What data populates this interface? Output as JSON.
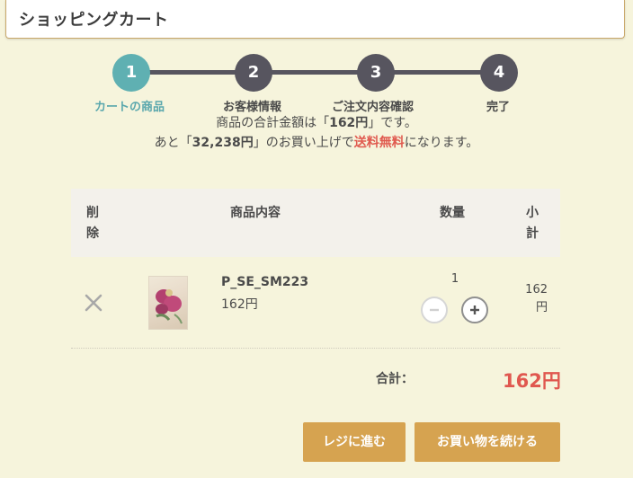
{
  "header": {
    "title": "ショッピングカート"
  },
  "steps": [
    {
      "number": "1",
      "label": "カートの商品",
      "active": true
    },
    {
      "number": "2",
      "label": "お客様情報"
    },
    {
      "number": "3",
      "label": "ご注文内容確認"
    },
    {
      "number": "4",
      "label": "完了"
    }
  ],
  "summary": {
    "line1_prefix": "商品の合計金額は「",
    "line1_amount": "162円",
    "line1_suffix": "」です。",
    "line2_prefix": "あと「",
    "line2_amount": "32,238円",
    "line2_mid": "」のお買い上げで",
    "line2_free": "送料無料",
    "line2_suffix": "になります。"
  },
  "table": {
    "headers": {
      "delete": "削\n除",
      "item": "商品内容",
      "qty": "数量",
      "subtotal": "小\n計"
    },
    "rows": [
      {
        "name": "P_SE_SM223",
        "price": "162円",
        "quantity": "1",
        "subtotal": "162\n円"
      }
    ]
  },
  "total": {
    "label": "合計：",
    "value": "162円"
  },
  "buttons": {
    "checkout": "レジに進む",
    "continue": "お買い物を続ける"
  },
  "colors": {
    "accent_active": "#5fb0b2",
    "step_inactive": "#57555f",
    "highlight_red": "#e0574f",
    "button": "#d6a350"
  }
}
